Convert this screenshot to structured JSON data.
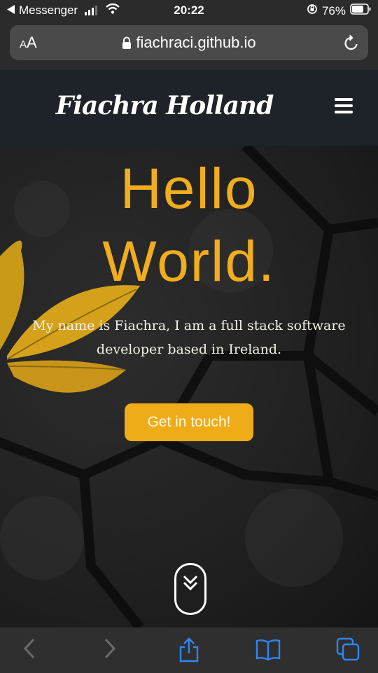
{
  "status_bar": {
    "back_app": "Messenger",
    "time": "20:22",
    "battery": "76%"
  },
  "browser": {
    "text_size_label": "AA",
    "url": "fiachraci.github.io"
  },
  "site": {
    "brand": "Fiachra Holland",
    "hero_line1": "Hello",
    "hero_line2": "World.",
    "intro": "My name is Fiachra, I am a full stack software developer based in Ireland.",
    "cta_label": "Get in touch!"
  },
  "colors": {
    "accent": "#f0ac17",
    "nav_bg": "#1e2329",
    "browser_chrome": "#2b2b2b",
    "toolbar_icon_active": "#2f86f6",
    "toolbar_icon_disabled": "#6b6b6b"
  },
  "toolbar": {
    "icons": [
      "back-icon",
      "forward-icon",
      "share-icon",
      "bookmarks-icon",
      "tabs-icon"
    ]
  }
}
